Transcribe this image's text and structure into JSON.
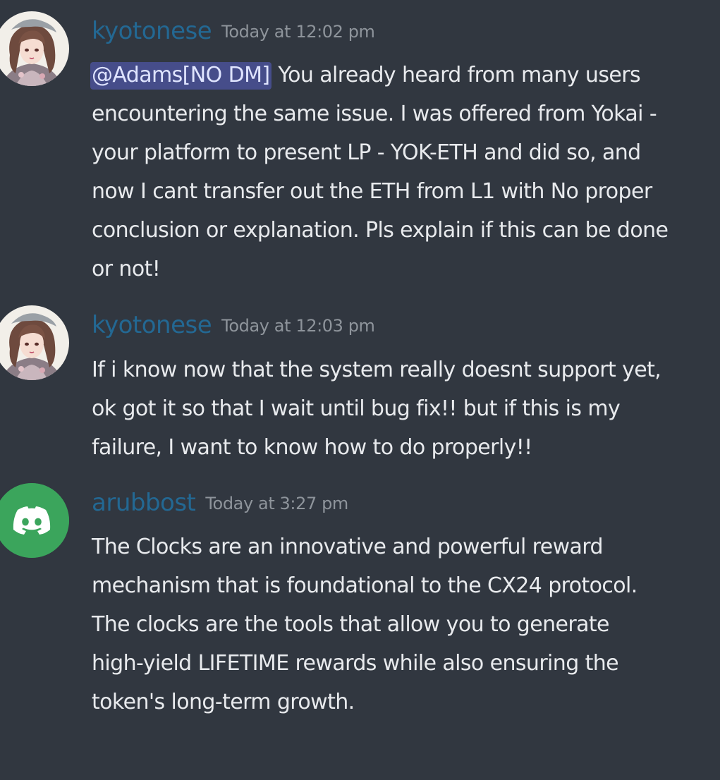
{
  "messages": [
    {
      "author": "kyotonese",
      "timestamp": "Today at 12:02 pm",
      "avatar_icon": "anime-girl-avatar",
      "mention": "@Adams[NO DM]",
      "lines": [
        " You already heard from many users",
        "encountering the same issue. I was offered from Yokai -",
        "your platform to present LP - YOK-ETH and did so, and",
        "now I cant transfer out the ETH from L1 with No proper",
        "conclusion or explanation. Pls explain if this can be done",
        "or not!"
      ]
    },
    {
      "author": "kyotonese",
      "timestamp": "Today at 12:03 pm",
      "avatar_icon": "anime-girl-avatar",
      "lines": [
        "If i know now that the system really doesnt support yet,",
        "ok got it so that I wait until bug fix!! but if this is my",
        "failure, I want to know how to do properly!!"
      ]
    },
    {
      "author": "arubbost",
      "timestamp": "Today at 3:27 pm",
      "avatar_icon": "discord-logo-avatar",
      "avatar_color": "#3ba55c",
      "lines": [
        "The Clocks are an innovative and powerful reward",
        "mechanism that is foundational to the CX24 protocol.",
        "The clocks are the tools that allow you to generate",
        "high-yield LIFETIME rewards while also ensuring the",
        "token's long-term growth."
      ]
    }
  ],
  "colors": {
    "background": "#313740",
    "username": "#236893",
    "timestamp": "#8e949b",
    "mention_bg": "#464d8a"
  }
}
